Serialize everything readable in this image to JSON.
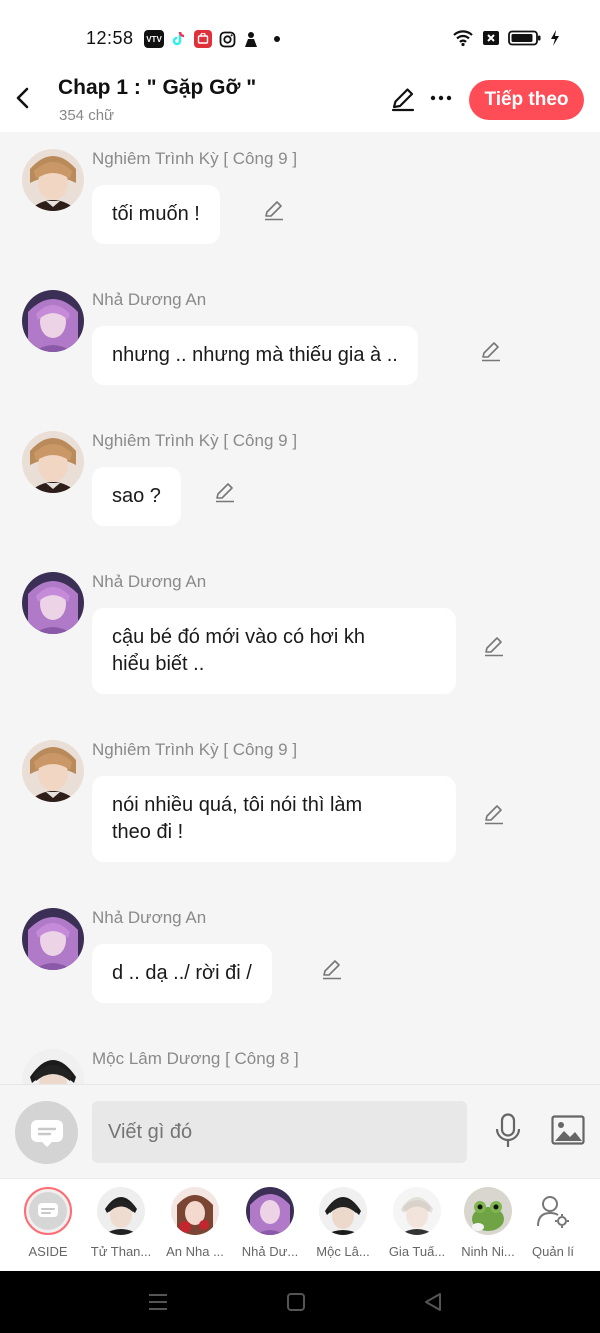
{
  "status_bar": {
    "time": "12:58",
    "apps": [
      {
        "name": "vtv-icon",
        "color": "#111111",
        "label": "VTV"
      },
      {
        "name": "tiktok-icon",
        "color": "#ffffff",
        "label": ""
      },
      {
        "name": "shop-icon",
        "color": "#e0303a",
        "label": ""
      },
      {
        "name": "instagram-icon",
        "color": "#ffffff",
        "label": ""
      },
      {
        "name": "people-icon",
        "color": "#ffffff",
        "label": ""
      }
    ]
  },
  "header": {
    "title": "Chap 1 : \" Gặp Gỡ \"",
    "word_count": "354 chữ",
    "next_label": "Tiếp theo"
  },
  "messages": [
    {
      "sender": "Nghiêm Trình Kỳ [ Công 9 ]",
      "text": "tối muốn !",
      "avatar": "male-blond"
    },
    {
      "sender": "Nhả Dương An",
      "text": "nhưng .. nhưng mà thiếu gia à ..",
      "avatar": "female-purple"
    },
    {
      "sender": "Nghiêm Trình Kỳ [ Công 9 ]",
      "text": "sao ?",
      "avatar": "male-blond"
    },
    {
      "sender": "Nhả Dương An",
      "text": "cậu bé đó mới vào có hơi kh\nhiểu biết ..",
      "avatar": "female-purple"
    },
    {
      "sender": "Nghiêm Trình Kỳ [ Công 9 ]",
      "text": "nói nhiều quá, tôi nói thì làm\ntheo đi !",
      "avatar": "male-blond"
    },
    {
      "sender": "Nhả Dương An",
      "text": "d .. dạ ../ rời đi /",
      "avatar": "female-purple"
    },
    {
      "sender": "Mộc Lâm Dương [ Công 8 ]",
      "text": "",
      "avatar": "male-dark"
    }
  ],
  "composer": {
    "placeholder": "Viết gì đó"
  },
  "characters": [
    {
      "name": "ASIDE",
      "avatar": "aside"
    },
    {
      "name": "Tử Than...",
      "avatar": "male-dark"
    },
    {
      "name": "An Nha ...",
      "avatar": "female-red"
    },
    {
      "name": "Nhả Dư...",
      "avatar": "female-purple"
    },
    {
      "name": "Mộc Lâ...",
      "avatar": "male-dark2"
    },
    {
      "name": "Gia Tuấ...",
      "avatar": "male-white"
    },
    {
      "name": "Ninh Ni...",
      "avatar": "frog"
    },
    {
      "name": "Quản lí",
      "avatar": "manage"
    }
  ],
  "colors": {
    "accent": "#ff4d57",
    "background": "#f5f5f5",
    "bubble": "#ffffff",
    "sender_text": "#8a8a8a"
  }
}
